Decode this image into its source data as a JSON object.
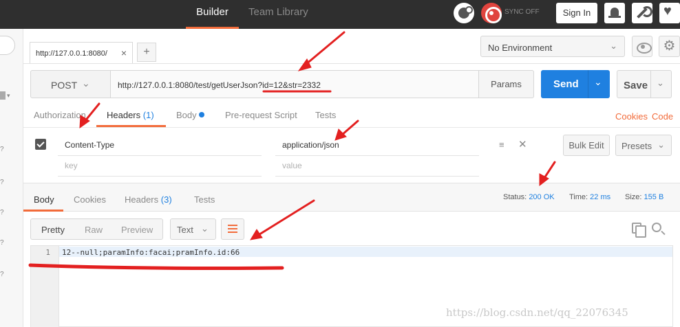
{
  "topbar": {
    "tabs": [
      "Builder",
      "Team Library"
    ],
    "sync_label": "SYNC OFF",
    "sign_in": "Sign In"
  },
  "request_tab": {
    "label": "http://127.0.0.1:8080/",
    "close": "×",
    "add": "+"
  },
  "environment": {
    "selected": "No Environment"
  },
  "request": {
    "method": "POST",
    "url": "http://127.0.0.1:8080/test/getUserJson?id=12&str=2332",
    "params_label": "Params",
    "send_label": "Send",
    "save_label": "Save"
  },
  "request_tabs": {
    "authorization": "Authorization",
    "headers": "Headers",
    "headers_count": "(1)",
    "body": "Body",
    "prerequest": "Pre-request Script",
    "tests": "Tests",
    "cookies": "Cookies",
    "code": "Code"
  },
  "headers_table": {
    "row1_key": "Content-Type",
    "row1_value": "application/json",
    "key_placeholder": "key",
    "value_placeholder": "value",
    "bulk_edit": "Bulk Edit",
    "presets": "Presets"
  },
  "response_tabs": {
    "body": "Body",
    "cookies": "Cookies",
    "headers": "Headers",
    "headers_count": "(3)",
    "tests": "Tests"
  },
  "response_meta": {
    "status_label": "Status:",
    "status_value": "200 OK",
    "time_label": "Time:",
    "time_value": "22 ms",
    "size_label": "Size:",
    "size_value": "155 B"
  },
  "format": {
    "pretty": "Pretty",
    "raw": "Raw",
    "preview": "Preview",
    "type": "Text"
  },
  "editor": {
    "line_number": "1",
    "line_text": "12--null;paramInfo:facai;pramInfo.id:66"
  },
  "watermark": "https://blog.csdn.net/qq_22076345",
  "colors": {
    "accent_orange": "#f26b3a",
    "send_blue": "#1f80e0",
    "annotation_red": "#e32020",
    "topbar": "#2f2f2f"
  }
}
